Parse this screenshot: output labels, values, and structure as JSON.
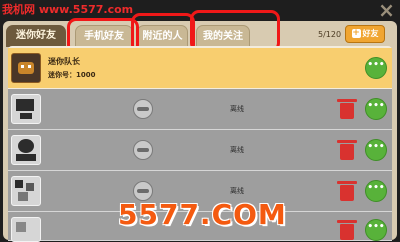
{
  "watermark_top": "我机网 www.5577.com",
  "watermark_bottom": "5577.COM",
  "tabs": {
    "mini_friends": "迷你好友",
    "phone_friends": "手机好友",
    "nearby": "附近的人",
    "following": "我的关注"
  },
  "friend_count": "5/120",
  "add_friend": "好友",
  "add_icon": "+",
  "close_icon": "×",
  "chat_icon": "•••",
  "me": {
    "name": "迷你队长",
    "id_line": "迷你号：1000"
  },
  "offline_label": "离线",
  "colors": {
    "accent_red": "#f01818",
    "chat_green": "#58b23a",
    "add_orange": "#f0a531"
  }
}
